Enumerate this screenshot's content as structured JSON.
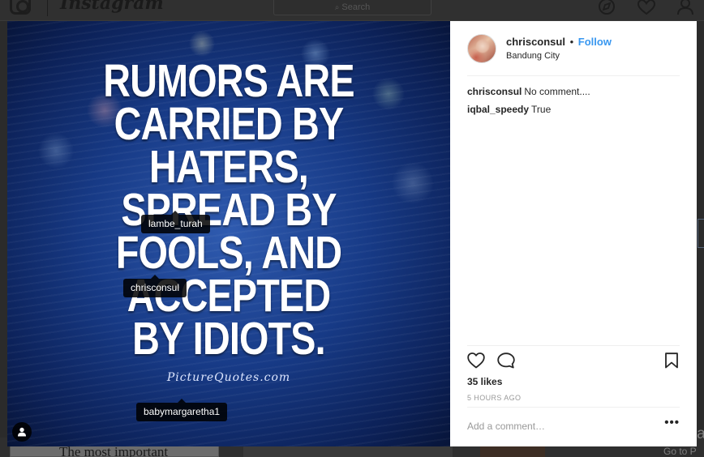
{
  "background": {
    "wordmark": "Instagram",
    "search_placeholder": "Search",
    "card_text": "The most important",
    "activate_text": "Activa",
    "activate_sub": "Go to P"
  },
  "post": {
    "quote_lines": [
      "RUMORS ARE",
      "CARRIED BY",
      "HATERS,",
      "SPREAD BY",
      "FOOLS, AND",
      "ACCEPTED",
      "BY IDIOTS."
    ],
    "quote_source": "PictureQuotes.com",
    "tags": [
      "lambe_turah",
      "chrisconsul",
      "babymargaretha1"
    ]
  },
  "author": {
    "username": "chrisconsul",
    "separator": "•",
    "follow_label": "Follow",
    "location": "Bandung City"
  },
  "comments": [
    {
      "author": "chrisconsul",
      "text": "No comment...."
    },
    {
      "author": "iqbal_speedy",
      "text": "True"
    }
  ],
  "likes": "35 likes",
  "timestamp": "5 HOURS AGO",
  "add_comment_placeholder": "Add a comment…",
  "more_label": "•••",
  "colors": {
    "follow": "#3897f0",
    "modal_bg": "#ffffff",
    "overlay": "#2b2b2b"
  },
  "icons": [
    "heart-icon",
    "comment-icon",
    "bookmark-icon",
    "explore-icon",
    "activity-heart-icon",
    "profile-icon",
    "user-tag-icon"
  ]
}
